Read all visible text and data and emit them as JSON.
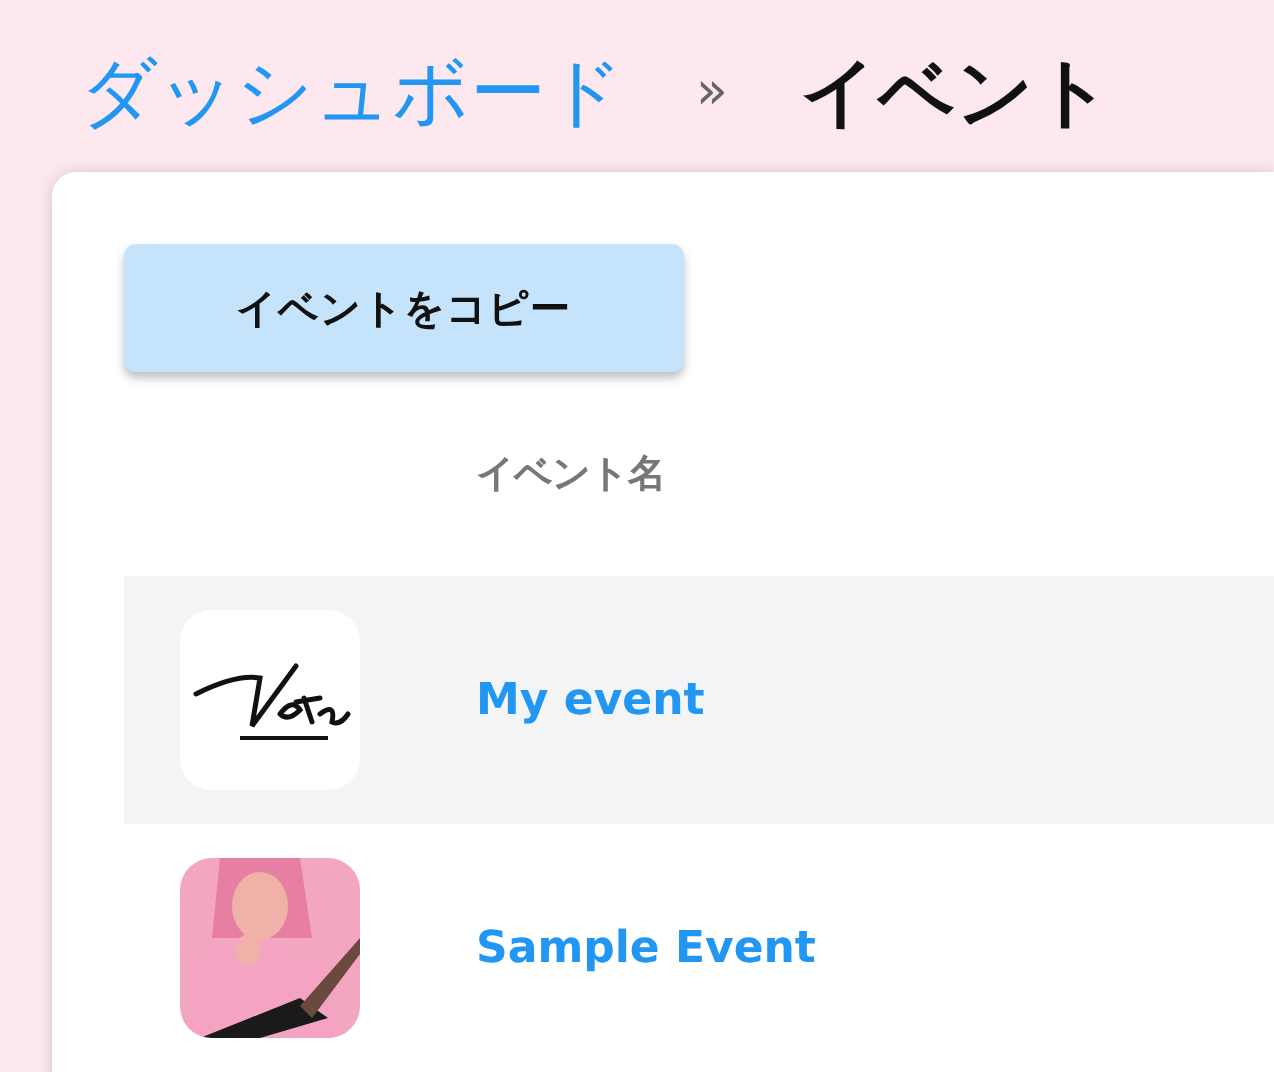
{
  "breadcrumb": {
    "items": [
      {
        "label": "ダッシュボード",
        "kind": "link"
      },
      {
        "label": "»",
        "kind": "separator"
      },
      {
        "label": "イベント",
        "kind": "current"
      }
    ]
  },
  "copy_button": {
    "label": "イベントをコピー"
  },
  "table": {
    "columns": [
      {
        "label": "イベント名"
      }
    ],
    "rows": [
      {
        "name": "My event",
        "selected": true,
        "thumbnail": {
          "kind": "logo"
        }
      },
      {
        "name": "Sample Event",
        "selected": false
      }
    ]
  }
}
